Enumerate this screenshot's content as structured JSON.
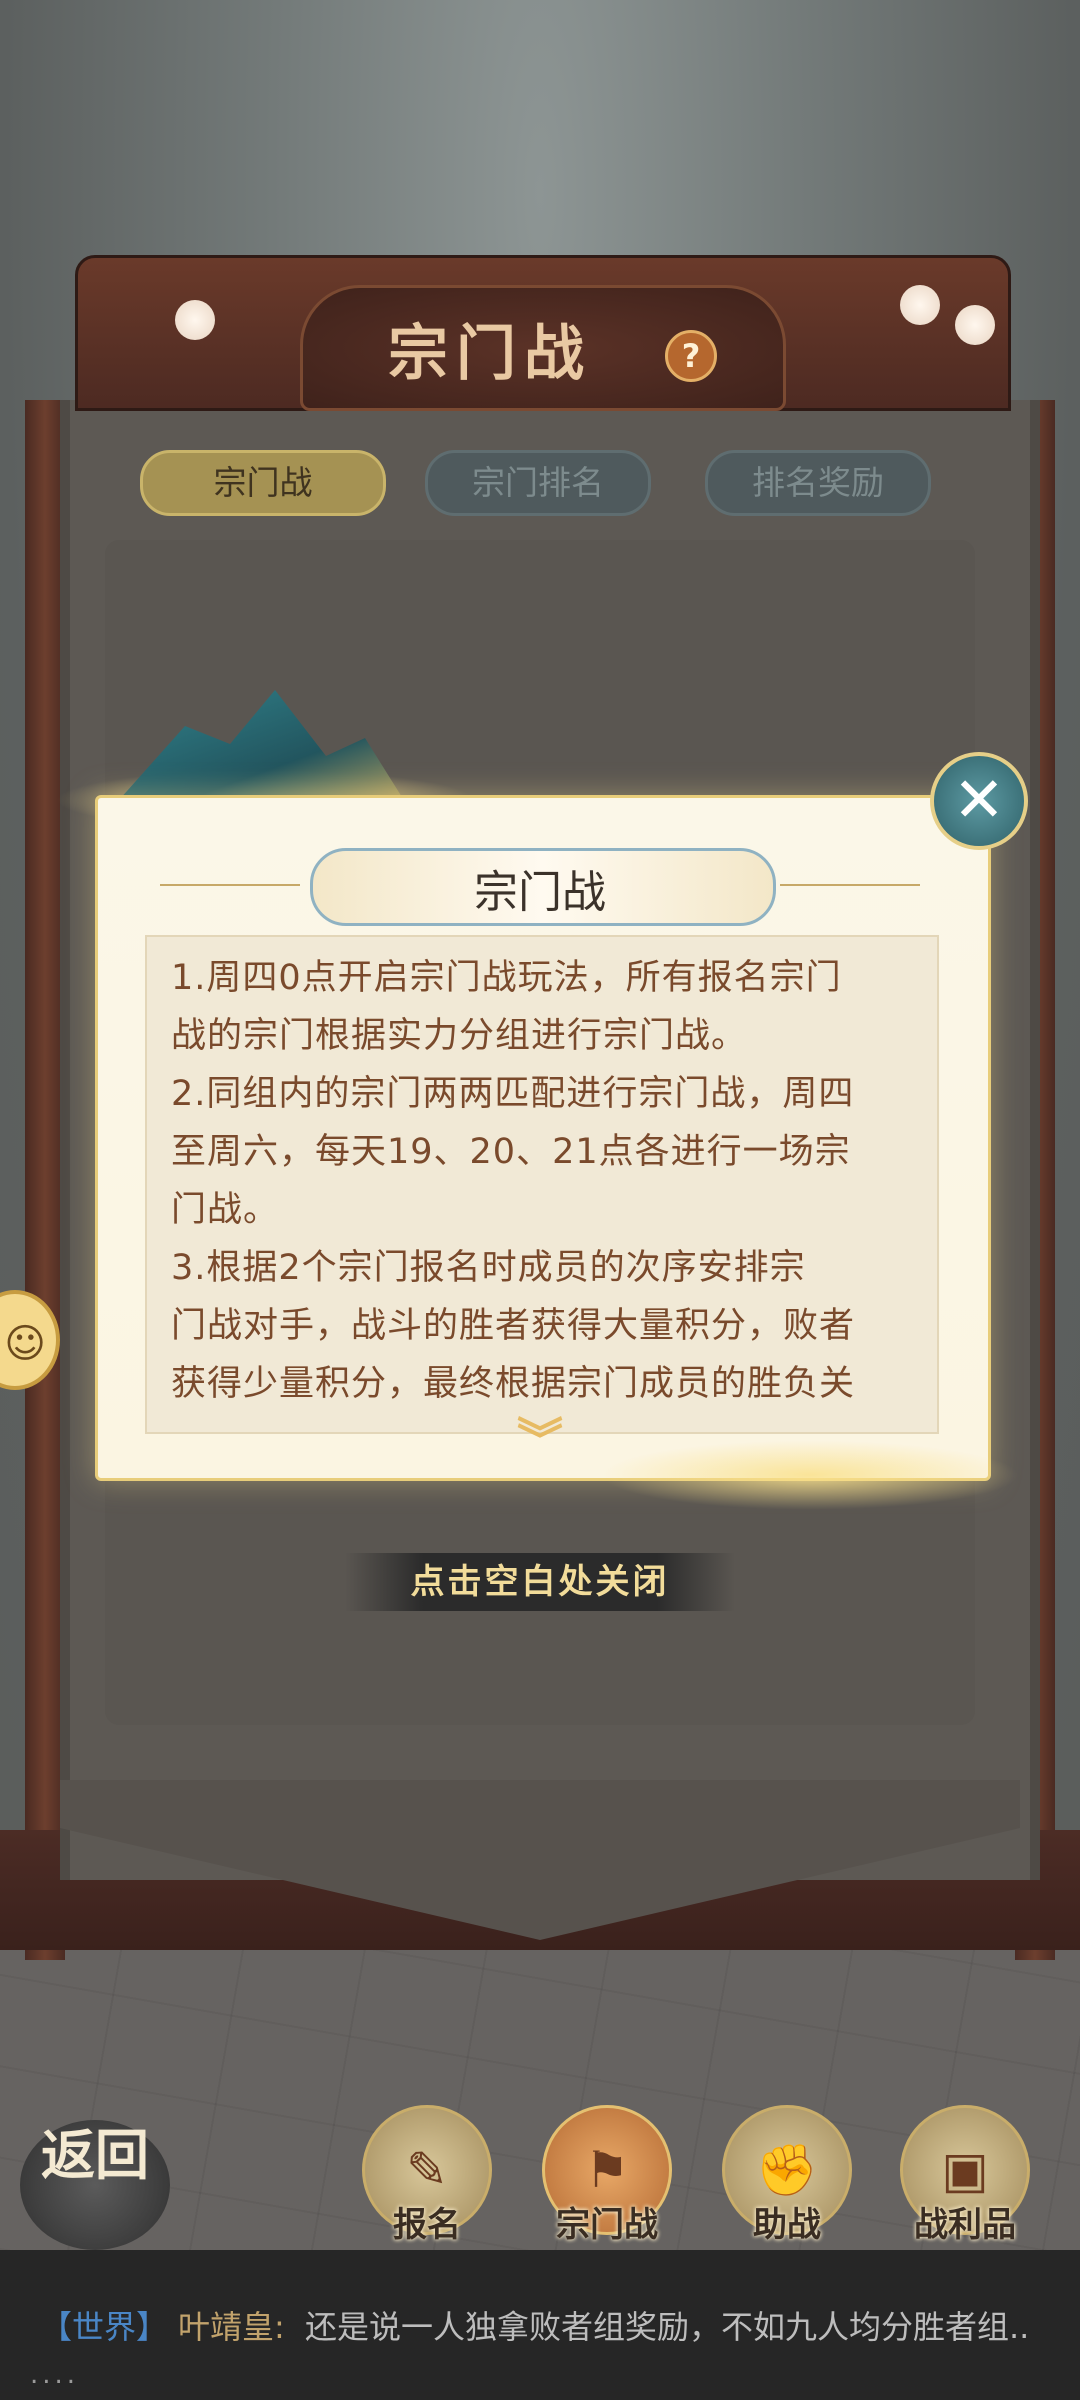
{
  "header": {
    "title": "宗门战",
    "help_glyph": "?"
  },
  "tabs": [
    {
      "label": "宗门战",
      "active": true
    },
    {
      "label": "宗门排名",
      "active": false
    },
    {
      "label": "排名奖励",
      "active": false
    }
  ],
  "modal": {
    "title": "宗门战",
    "close_glyph": "✕",
    "rules": [
      "1.周四0点开启宗门战玩法，所有报名宗门",
      "战的宗门根据实力分组进行宗门战。",
      "2.同组内的宗门两两匹配进行宗门战，周四",
      "至周六，每天19、20、21点各进行一场宗",
      "门战。",
      "3.根据2个宗门报名时成员的次序安排宗",
      "门战对手，战斗的胜者获得大量积分，败者",
      "获得少量积分，最终根据宗门成员的胜负关"
    ],
    "more_glyph": "︾"
  },
  "hint": "点击空白处关闭",
  "side_button_glyph": "☺",
  "bottom_nav": {
    "back_label": "返回",
    "items": [
      {
        "label": "报名",
        "icon": "signup-scroll-icon",
        "glyph": "✎",
        "active": false
      },
      {
        "label": "宗门战",
        "icon": "sect-war-flag-icon",
        "glyph": "⚑",
        "active": true
      },
      {
        "label": "助战",
        "icon": "assist-handshake-icon",
        "glyph": "✊",
        "active": false
      },
      {
        "label": "战利品",
        "icon": "loot-chest-icon",
        "glyph": "▣",
        "active": false
      }
    ]
  },
  "chat": {
    "channel": "【世界】",
    "sender": "叶靖皇:",
    "message": "还是说一人独拿败者组奖励，不如九人均分胜者组..",
    "dots": "...."
  },
  "colors": {
    "accent_gold": "#e8cd7a",
    "tab_active": "#a59253",
    "rule_text": "#7a4a2c",
    "chat_channel": "#4a86c6"
  }
}
